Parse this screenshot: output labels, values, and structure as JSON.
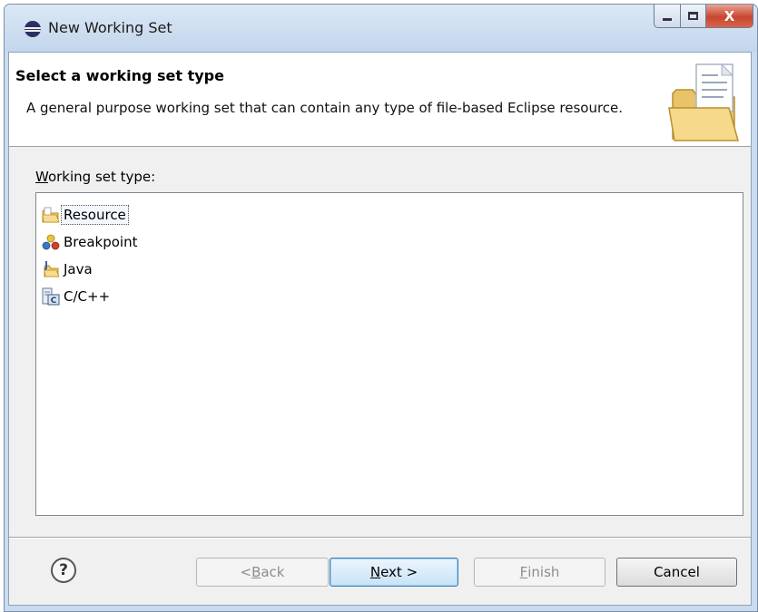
{
  "window": {
    "title": "New Working Set",
    "controls": {
      "minimize": "minimize",
      "maximize": "maximize",
      "close": "X"
    }
  },
  "banner": {
    "title": "Select a working set type",
    "description": "A general purpose working set that can contain any type of file-based Eclipse resource.",
    "icon": "folder-document-icon"
  },
  "working_set": {
    "label_underlined": "W",
    "label_rest": "orking set type:",
    "items": [
      {
        "label": "Resource",
        "icon": "resource-folder-icon",
        "selected": true
      },
      {
        "label": "Breakpoint",
        "icon": "breakpoint-icon",
        "selected": false
      },
      {
        "label": "Java",
        "icon": "java-package-icon",
        "selected": false
      },
      {
        "label": "C/C++",
        "icon": "cpp-project-icon",
        "selected": false
      }
    ]
  },
  "footer": {
    "help": "?",
    "back": {
      "prefix": "< ",
      "mnemonic": "B",
      "rest": "ack",
      "enabled": false
    },
    "next": {
      "mnemonic": "N",
      "rest": "ext >",
      "enabled": true
    },
    "finish": {
      "mnemonic": "F",
      "rest": "inish",
      "enabled": false
    },
    "cancel": {
      "label": "Cancel",
      "enabled": true
    }
  },
  "colors": {
    "title_bar": "#c3d6ec",
    "close_button": "#c8452e",
    "dialog_bg": "#f0f0f0",
    "default_button_border": "#3c7fb1"
  }
}
